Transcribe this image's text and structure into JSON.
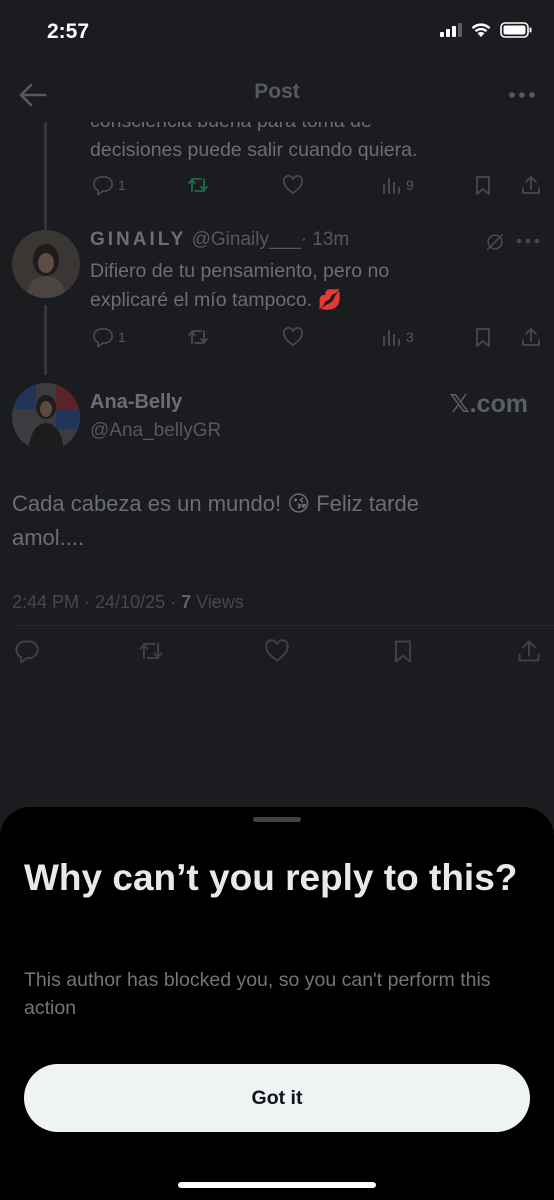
{
  "status_bar": {
    "time": "2:57"
  },
  "header": {
    "title": "Post"
  },
  "previous_reply": {
    "text_partial": "consciencia buena para toma de",
    "text_line2": "decisiones puede salir cuando quiera.",
    "replies": "1",
    "views": "9"
  },
  "reply": {
    "name": "GINAILY",
    "handle": "@Ginaily___",
    "time": "· 13m",
    "text_line1": "Difiero de tu pensamiento, pero no",
    "text_line2": "explicaré el mío tampoco. 💋",
    "replies": "1",
    "views": "3"
  },
  "main_post": {
    "name": "Ana-Belly",
    "handle": "@Ana_bellyGR",
    "watermark": "𝕏.com",
    "text_line1": "Cada cabeza es un mundo! 😘 Feliz tarde",
    "text_line2": "amol....",
    "meta_time": "2:44 PM · 24/10/25 · ",
    "meta_views_count": "7",
    "meta_views_label": " Views"
  },
  "sheet": {
    "title": "Why can’t you reply to this?",
    "body": "This author has blocked you, so you can't perform this action",
    "button_label": "Got it"
  },
  "colors": {
    "dimmed_bg": "#1b1c1f",
    "sheet_bg": "#000000",
    "retweet_green": "#1f6b4d",
    "button_bg": "#eff3f4"
  }
}
